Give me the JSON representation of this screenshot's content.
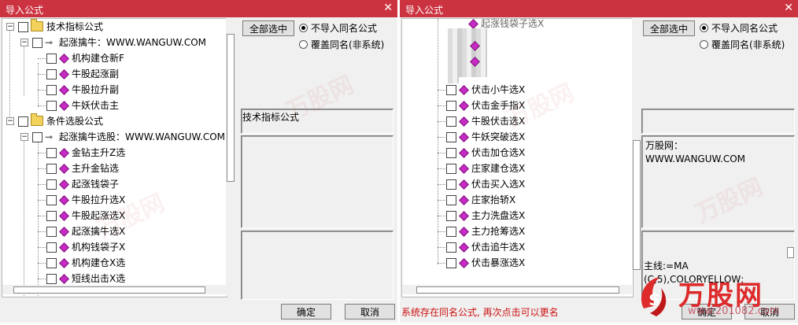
{
  "colors": {
    "titlebar": "#cc3340",
    "diamond": "#c72bc4",
    "status": "#cc1111",
    "logo": "#dd2a2a"
  },
  "left": {
    "title": "导入公式",
    "tree": [
      {
        "label": "技术指标公式",
        "level": 0,
        "kind": "folder"
      },
      {
        "label": "起涨擒牛：WWW.WANGUW.COM",
        "level": 1,
        "kind": "key"
      },
      {
        "label": "机构建仓新F",
        "level": 2,
        "kind": "item"
      },
      {
        "label": "牛股起涨副",
        "level": 2,
        "kind": "item"
      },
      {
        "label": "牛股拉升副",
        "level": 2,
        "kind": "item"
      },
      {
        "label": "牛妖伏击主",
        "level": 2,
        "kind": "item"
      },
      {
        "label": "条件选股公式",
        "level": 0,
        "kind": "folder"
      },
      {
        "label": "起涨擒牛选股：WWW.WANGUW.COM",
        "level": 1,
        "kind": "key"
      },
      {
        "label": "金钻主升Z选",
        "level": 2,
        "kind": "item"
      },
      {
        "label": "主升金钻选",
        "level": 2,
        "kind": "item"
      },
      {
        "label": "起涨钱袋子",
        "level": 2,
        "kind": "item"
      },
      {
        "label": "牛股拉升选X",
        "level": 2,
        "kind": "item"
      },
      {
        "label": "牛股起涨选X",
        "level": 2,
        "kind": "item"
      },
      {
        "label": "起涨擒牛选X",
        "level": 2,
        "kind": "item"
      },
      {
        "label": "机构钱袋子X",
        "level": 2,
        "kind": "item"
      },
      {
        "label": "机构建仓X选",
        "level": 2,
        "kind": "item"
      },
      {
        "label": "短线出击X选",
        "level": 2,
        "kind": "item"
      }
    ],
    "select_all": "全部选中",
    "radio1": "不导入同名公式",
    "radio2": "覆盖同名(非系统)",
    "type_label": "技术指标公式",
    "ok": "确定",
    "cancel": "取消"
  },
  "right": {
    "title": "导入公式",
    "top_partial": "起涨钱袋子选X",
    "tree": [
      {
        "label": "伏击小牛选X"
      },
      {
        "label": "伏击金手指X"
      },
      {
        "label": "牛股伏击选X"
      },
      {
        "label": "牛妖突破选X"
      },
      {
        "label": "伏击加仓选X"
      },
      {
        "label": "庄家建仓选X"
      },
      {
        "label": "伏击买入选X"
      },
      {
        "label": "庄家抬轿X"
      },
      {
        "label": "主力洗盘选X"
      },
      {
        "label": "主力抢筹选X"
      },
      {
        "label": "伏击追牛选X"
      },
      {
        "label": "伏击暴涨选X"
      }
    ],
    "select_all": "全部选中",
    "radio1": "不导入同名公式",
    "radio2": "覆盖同名(非系统)",
    "desc_line1": "万股网：",
    "desc_line2": "WWW.WANGUW.COM",
    "code_line1": "主线:=MA",
    "code_line2": "(C,5),COLORYELLOW;",
    "status": "系统存在同名公式, 再次点击可以更名",
    "ok": "确定",
    "cancel": "取消"
  },
  "watermark": {
    "brand": "万股网",
    "site": "www.201082.com"
  }
}
